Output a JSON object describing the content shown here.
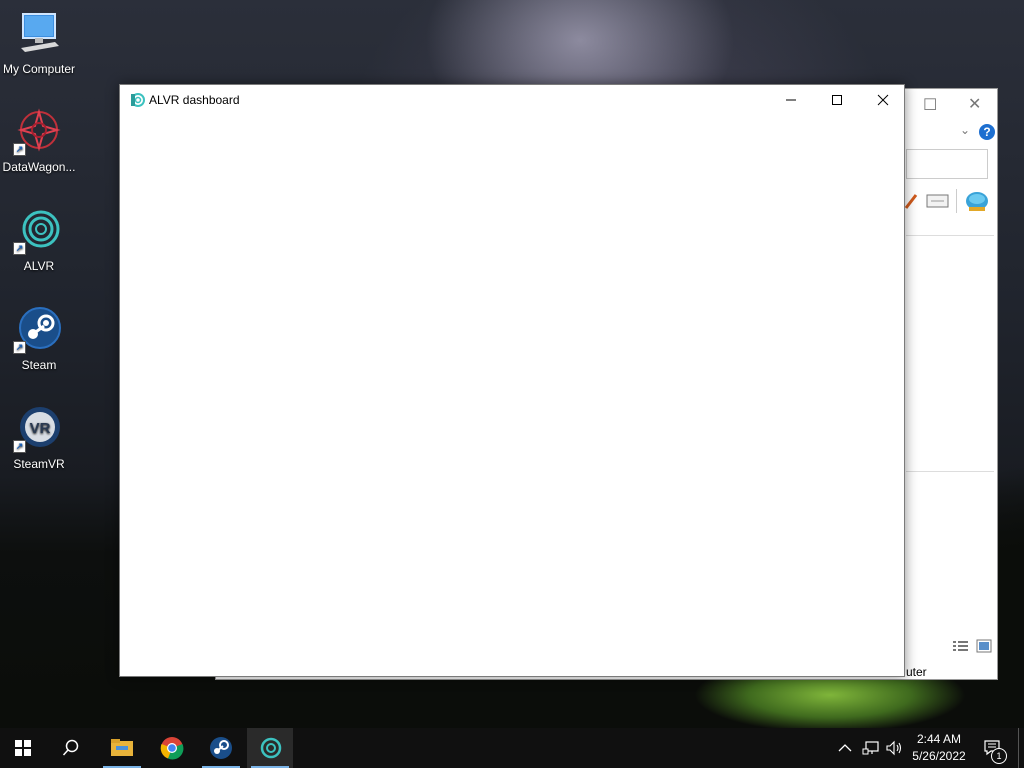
{
  "desktop": {
    "icons": [
      {
        "label": "My Computer"
      },
      {
        "label": "DataWagon..."
      },
      {
        "label": "ALVR"
      },
      {
        "label": "Steam"
      },
      {
        "label": "SteamVR"
      }
    ]
  },
  "background_window": {
    "status_text": "uter",
    "help_glyph": "?"
  },
  "alvr_window": {
    "title": "ALVR dashboard"
  },
  "taskbar": {
    "time": "2:44 AM",
    "date": "5/26/2022",
    "notification_count": "1"
  }
}
